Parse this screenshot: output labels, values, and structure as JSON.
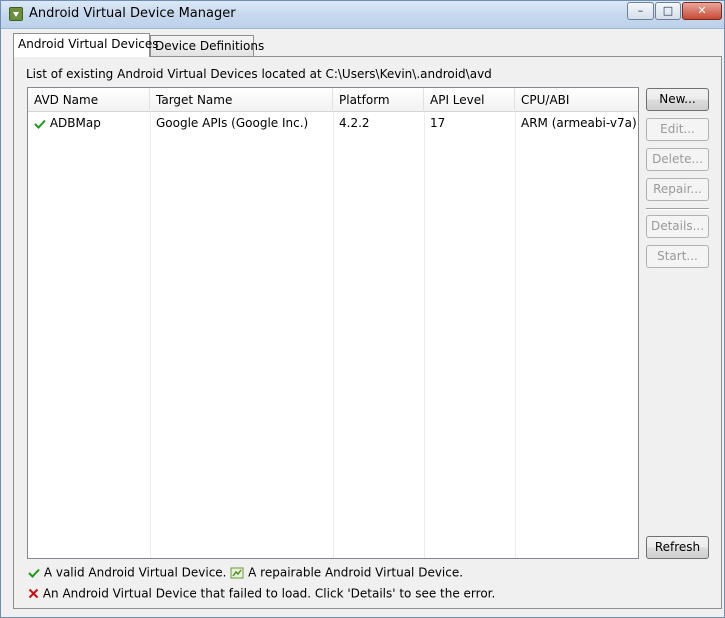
{
  "window": {
    "title": "Android Virtual Device Manager",
    "controls": {
      "minimize": "–",
      "maximize": "□",
      "close": "✕"
    }
  },
  "tabs": [
    {
      "label": "Android Virtual Devices",
      "active": true
    },
    {
      "label": "Device Definitions",
      "active": false
    }
  ],
  "avd_panel": {
    "path_label": "List of existing Android Virtual Devices located at C:\\Users\\Kevin\\.android\\avd",
    "columns": [
      "AVD Name",
      "Target Name",
      "Platform",
      "API Level",
      "CPU/ABI"
    ],
    "rows": [
      {
        "status_icon": "valid-check-icon",
        "name": "ADBMap",
        "target": "Google APIs (Google Inc.)",
        "platform": "4.2.2",
        "api_level": "17",
        "cpu_abi": "ARM (armeabi-v7a)"
      }
    ],
    "buttons": {
      "new": "New...",
      "edit": "Edit...",
      "delete": "Delete...",
      "repair": "Repair...",
      "details": "Details...",
      "start": "Start...",
      "refresh": "Refresh"
    },
    "legend": {
      "valid": "A valid Android Virtual Device.",
      "repairable": "A repairable Android Virtual Device.",
      "failed": "An Android Virtual Device that failed to load. Click 'Details' to see the error."
    }
  },
  "colors": {
    "valid": "#1a9a1a",
    "failed": "#cc1111",
    "selection_border": "#8e8f8f"
  }
}
